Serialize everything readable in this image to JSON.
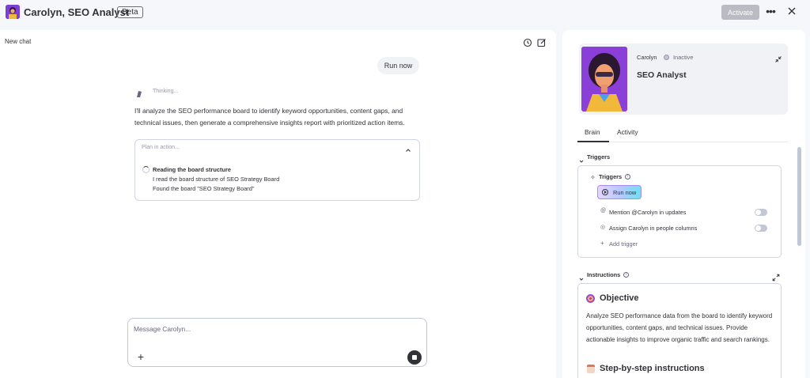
{
  "header": {
    "title": "Carolyn, SEO Analyst",
    "badge": "Beta",
    "activate_label": "Activate",
    "more_icon": "more-horizontal-icon",
    "close_icon": "close-icon"
  },
  "chat": {
    "new_chat_label": "New chat",
    "user_message": "Run now",
    "thinking_label": "Thinking...",
    "response": "I'll analyze the SEO performance board to identify keyword opportunities, content gaps, and technical issues, then generate a comprehensive insights report with prioritized action items.",
    "plan": {
      "title": "Plan in action...",
      "step_title": "Reading the board structure",
      "step_lines": [
        "I read the board structure of SEO Strategy Board",
        "Found the board \"SEO Strategy Board\""
      ]
    },
    "composer": {
      "placeholder": "Message Carolyn..."
    }
  },
  "agent": {
    "name": "Carolyn",
    "status": "Inactive",
    "role": "SEO Analyst"
  },
  "tabs": [
    {
      "label": "Brain",
      "active": true
    },
    {
      "label": "Activity",
      "active": false
    }
  ],
  "triggers": {
    "section_label": "Triggers",
    "box_title": "Triggers",
    "run_now_label": "Run now",
    "items": [
      {
        "label": "Mention @Carolyn in updates",
        "enabled": false
      },
      {
        "label": "Assign Carolyn in people columns",
        "enabled": false
      }
    ],
    "add_label": "Add trigger"
  },
  "instructions": {
    "section_label": "Instructions",
    "objective_title": "Objective",
    "objective_text": "Analyze SEO performance data from the board to identify keyword opportunities, content gaps, and technical issues. Provide actionable insights to improve organic traffic and search rankings.",
    "steps_title": "Step-by-step instructions"
  },
  "colors": {
    "accent": "#6c3fd1",
    "run_now_gradient": [
      "#e6d6ff",
      "#6fe0f0"
    ],
    "page_bg": "#f6f7fb"
  }
}
